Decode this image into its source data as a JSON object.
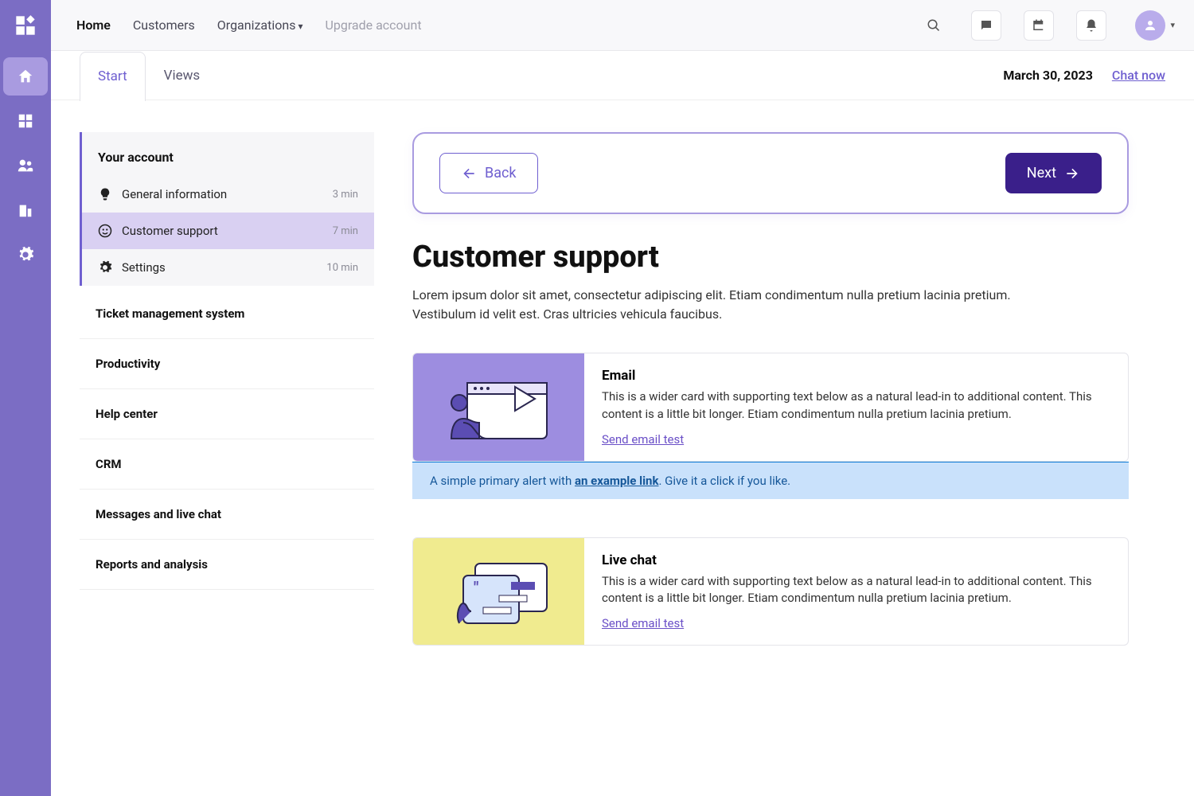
{
  "topbar": {
    "nav": [
      "Home",
      "Customers",
      "Organizations",
      "Upgrade account"
    ]
  },
  "subhdr": {
    "tabs": [
      "Start",
      "Views"
    ],
    "date": "March 30, 2023",
    "chat": "Chat now"
  },
  "sidemenu": {
    "group_title": "Your account",
    "items": [
      {
        "label": "General information",
        "time": "3 min"
      },
      {
        "label": "Customer support",
        "time": "7 min"
      },
      {
        "label": "Settings",
        "time": "10 min"
      }
    ],
    "links": [
      "Ticket management system",
      "Productivity",
      "Help center",
      "CRM",
      "Messages and live chat",
      "Reports and analysis"
    ]
  },
  "nav": {
    "back": "Back",
    "next": "Next"
  },
  "article": {
    "title": "Customer support",
    "lead": "Lorem ipsum dolor sit amet, consectetur adipiscing elit. Etiam condimentum nulla pretium lacinia pretium. Vestibulum id velit est. Cras ultricies vehicula faucibus."
  },
  "cards": [
    {
      "title": "Email",
      "body": "This is a wider card with supporting text below as a natural lead-in to additional content. This content is a little bit longer.  Etiam condimentum nulla pretium lacinia pretium.",
      "link": "Send email test"
    },
    {
      "title": "Live chat",
      "body": "This is a wider card with supporting text below as a natural lead-in to additional content. This content is a little bit longer.  Etiam condimentum nulla pretium lacinia pretium.",
      "link": "Send email test"
    }
  ],
  "alert": {
    "pre": "A simple primary alert with ",
    "link": "an example link",
    "post": ". Give it a click if you like."
  }
}
